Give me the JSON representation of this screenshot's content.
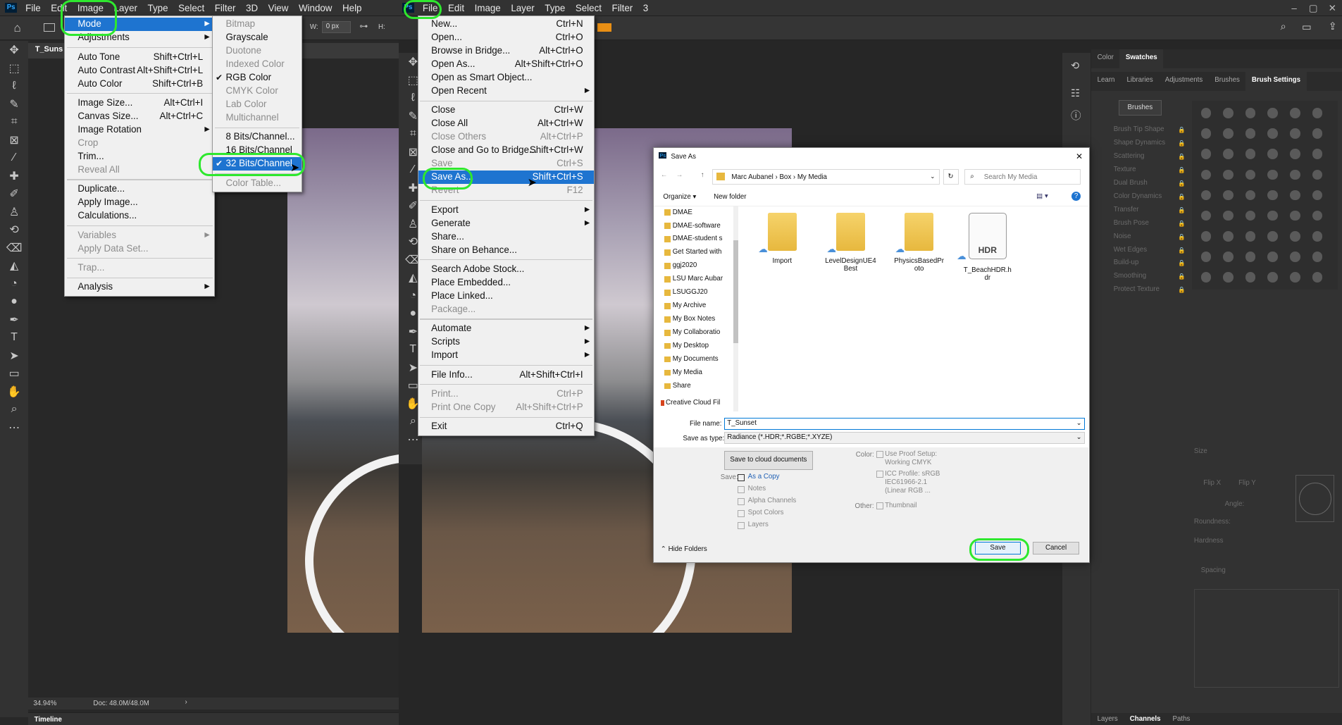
{
  "left_window": {
    "menubar": [
      "File",
      "Edit",
      "Image",
      "Layer",
      "Type",
      "Select",
      "Filter",
      "3D",
      "View",
      "Window",
      "Help"
    ],
    "doc_tab": "T_Suns",
    "width_label": "W:",
    "width_value": "0 px",
    "height_label": "H:",
    "status_zoom": "34.94%",
    "status_doc": "Doc: 48.0M/48.0M",
    "timeline": "Timeline"
  },
  "image_menu": {
    "items": [
      {
        "label": "Mode",
        "shortcut": "",
        "sub": true,
        "hl": true
      },
      {
        "label": "Adjustments",
        "shortcut": "",
        "sub": true
      },
      {
        "sep": true
      },
      {
        "label": "Auto Tone",
        "shortcut": "Shift+Ctrl+L"
      },
      {
        "label": "Auto Contrast",
        "shortcut": "Alt+Shift+Ctrl+L"
      },
      {
        "label": "Auto Color",
        "shortcut": "Shift+Ctrl+B"
      },
      {
        "sep": true
      },
      {
        "label": "Image Size...",
        "shortcut": "Alt+Ctrl+I"
      },
      {
        "label": "Canvas Size...",
        "shortcut": "Alt+Ctrl+C"
      },
      {
        "label": "Image Rotation",
        "shortcut": "",
        "sub": true
      },
      {
        "label": "Crop",
        "shortcut": "",
        "dis": true
      },
      {
        "label": "Trim...",
        "shortcut": ""
      },
      {
        "label": "Reveal All",
        "shortcut": "",
        "dis": true
      },
      {
        "sep": true
      },
      {
        "label": "Duplicate...",
        "shortcut": ""
      },
      {
        "label": "Apply Image...",
        "shortcut": ""
      },
      {
        "label": "Calculations...",
        "shortcut": ""
      },
      {
        "sep": true
      },
      {
        "label": "Variables",
        "shortcut": "",
        "sub": true,
        "dis": true
      },
      {
        "label": "Apply Data Set...",
        "shortcut": "",
        "dis": true
      },
      {
        "sep": true
      },
      {
        "label": "Trap...",
        "shortcut": "",
        "dis": true
      },
      {
        "sep": true
      },
      {
        "label": "Analysis",
        "shortcut": "",
        "sub": true
      }
    ]
  },
  "mode_menu": {
    "items": [
      {
        "label": "Bitmap",
        "dis": true
      },
      {
        "label": "Grayscale"
      },
      {
        "label": "Duotone",
        "dis": true
      },
      {
        "label": "Indexed Color",
        "dis": true
      },
      {
        "label": "RGB Color",
        "chk": true
      },
      {
        "label": "CMYK Color",
        "dis": true
      },
      {
        "label": "Lab Color",
        "dis": true
      },
      {
        "label": "Multichannel",
        "dis": true
      },
      {
        "sep": true
      },
      {
        "label": "8 Bits/Channel..."
      },
      {
        "label": "16 Bits/Channel"
      },
      {
        "label": "32 Bits/Channel",
        "chk": true,
        "hl": true
      },
      {
        "sep": true
      },
      {
        "label": "Color Table...",
        "dis": true
      }
    ]
  },
  "right_window": {
    "menubar": [
      "File",
      "Edit",
      "Image",
      "Layer",
      "Type",
      "Select",
      "Filter",
      "3"
    ],
    "panel_tabs1": [
      "Color",
      "Swatches"
    ],
    "panel_tabs2": [
      "Learn",
      "Libraries",
      "Adjustments",
      "Brushes",
      "Brush Settings"
    ],
    "brushes_btn": "Brushes",
    "brush_settings": [
      "Brush Tip Shape",
      "Shape Dynamics",
      "Scattering",
      "Texture",
      "Dual Brush",
      "Color Dynamics",
      "Transfer",
      "Brush Pose",
      "Noise",
      "Wet Edges",
      "Build-up",
      "Smoothing",
      "Protect Texture"
    ],
    "size_label": "Size",
    "flipx": "Flip X",
    "flipy": "Flip Y",
    "angle": "Angle:",
    "roundness": "Roundness:",
    "hardness": "Hardness",
    "spacing": "Spacing",
    "bottom_tabs": [
      "Layers",
      "Channels",
      "Paths"
    ]
  },
  "file_menu": {
    "items": [
      {
        "label": "New...",
        "shortcut": "Ctrl+N"
      },
      {
        "label": "Open...",
        "shortcut": "Ctrl+O"
      },
      {
        "label": "Browse in Bridge...",
        "shortcut": "Alt+Ctrl+O"
      },
      {
        "label": "Open As...",
        "shortcut": "Alt+Shift+Ctrl+O"
      },
      {
        "label": "Open as Smart Object...",
        "shortcut": ""
      },
      {
        "label": "Open Recent",
        "shortcut": "",
        "sub": true
      },
      {
        "sep": true
      },
      {
        "label": "Close",
        "shortcut": "Ctrl+W"
      },
      {
        "label": "Close All",
        "shortcut": "Alt+Ctrl+W"
      },
      {
        "label": "Close Others",
        "shortcut": "Alt+Ctrl+P",
        "dis": true
      },
      {
        "label": "Close and Go to Bridge...",
        "shortcut": "Shift+Ctrl+W"
      },
      {
        "label": "Save",
        "shortcut": "Ctrl+S",
        "dis": true
      },
      {
        "label": "Save As...",
        "shortcut": "Shift+Ctrl+S",
        "hl": true
      },
      {
        "label": "Revert",
        "shortcut": "F12",
        "dis": true
      },
      {
        "sep": true
      },
      {
        "label": "Export",
        "shortcut": "",
        "sub": true
      },
      {
        "label": "Generate",
        "shortcut": "",
        "sub": true
      },
      {
        "label": "Share...",
        "shortcut": ""
      },
      {
        "label": "Share on Behance...",
        "shortcut": ""
      },
      {
        "sep": true
      },
      {
        "label": "Search Adobe Stock...",
        "shortcut": ""
      },
      {
        "label": "Place Embedded...",
        "shortcut": ""
      },
      {
        "label": "Place Linked...",
        "shortcut": ""
      },
      {
        "label": "Package...",
        "shortcut": "",
        "dis": true
      },
      {
        "sep": true
      },
      {
        "label": "Automate",
        "shortcut": "",
        "sub": true
      },
      {
        "label": "Scripts",
        "shortcut": "",
        "sub": true
      },
      {
        "label": "Import",
        "shortcut": "",
        "sub": true
      },
      {
        "sep": true
      },
      {
        "label": "File Info...",
        "shortcut": "Alt+Shift+Ctrl+I"
      },
      {
        "sep": true
      },
      {
        "label": "Print...",
        "shortcut": "Ctrl+P",
        "dis": true
      },
      {
        "label": "Print One Copy",
        "shortcut": "Alt+Shift+Ctrl+P",
        "dis": true
      },
      {
        "sep": true
      },
      {
        "label": "Exit",
        "shortcut": "Ctrl+Q"
      }
    ]
  },
  "save_dialog": {
    "title": "Save As",
    "breadcrumb": [
      "Marc Aubanel",
      "Box",
      "My Media"
    ],
    "search_placeholder": "Search My Media",
    "organize": "Organize",
    "new_folder": "New folder",
    "tree": [
      "DMAE",
      "DMAE-software",
      "DMAE-student s",
      "Get Started with",
      "ggj2020",
      "LSU Marc Aubar",
      "LSUGGJ20",
      "My Archive",
      "My Box Notes",
      "My Collaboratio",
      "My Desktop",
      "My Documents",
      "My Media",
      "Share",
      "Creative Cloud Fil"
    ],
    "files": [
      {
        "name": "Import",
        "type": "folder"
      },
      {
        "name": "LevelDesignUE4Best",
        "type": "folder"
      },
      {
        "name": "PhysicsBasedProto",
        "type": "folder"
      },
      {
        "name": "T_BeachHDR.hdr",
        "type": "hdr",
        "badge": "HDR"
      }
    ],
    "file_name_label": "File name:",
    "file_name": "T_Sunset",
    "save_type_label": "Save as type:",
    "save_type": "Radiance (*.HDR;*.RGBE;*.XYZE)",
    "cloud_btn": "Save to cloud documents",
    "save_label": "Save:",
    "as_copy": "As a Copy",
    "notes": "Notes",
    "alpha": "Alpha Channels",
    "spot": "Spot Colors",
    "layers": "Layers",
    "color_label": "Color:",
    "proof": "Use Proof Setup: Working CMYK",
    "icc": "ICC Profile: sRGB IEC61966-2.1 (Linear RGB ...",
    "other_label": "Other:",
    "thumbnail": "Thumbnail",
    "hide_folders": "Hide Folders",
    "save_btn": "Save",
    "cancel_btn": "Cancel"
  }
}
